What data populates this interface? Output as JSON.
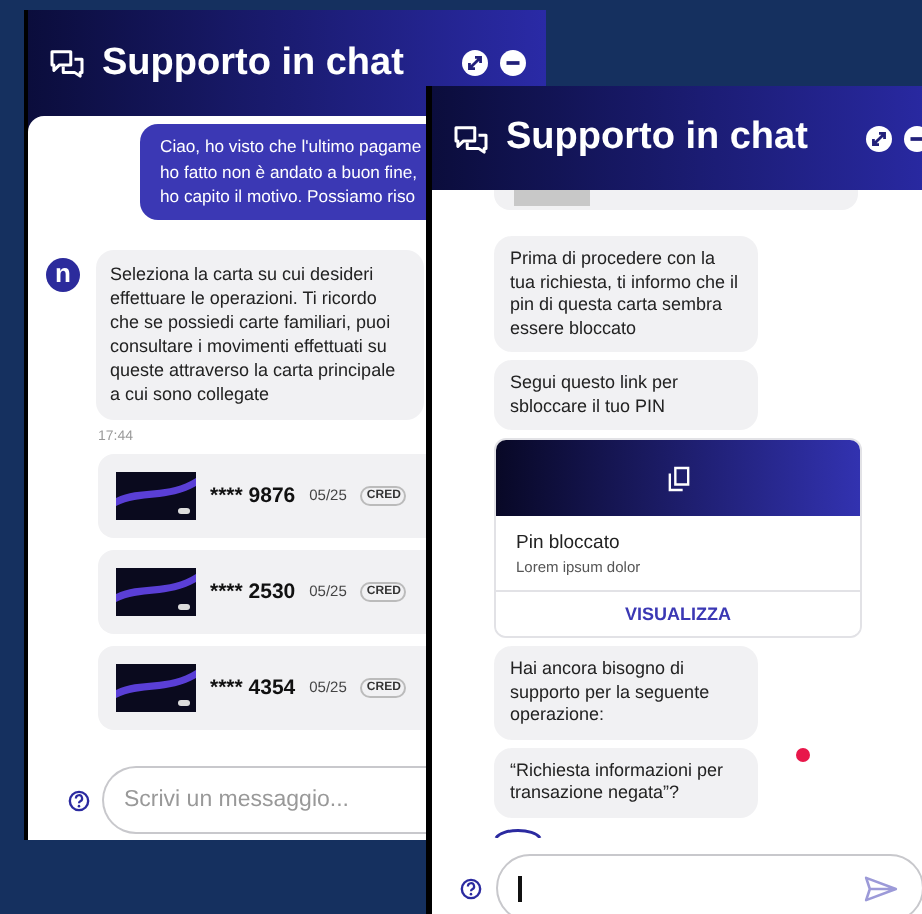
{
  "windows": [
    {
      "title": "Supporto in chat",
      "messages": [
        {
          "kind": "user",
          "lines": [
            "Ciao, ho visto che l'ultimo pagame",
            "ho fatto non è andato a buon fine,",
            "ho capito il motivo. Possiamo riso"
          ]
        },
        {
          "kind": "bot",
          "avatar": "n",
          "text": "Seleziona la carta su cui desideri effettuare le operazioni. Ti ricordo che se possiedi carte familiari, puoi consultare i movimenti effettuati su queste attraverso la carta principale a cui sono collegate",
          "unread": false
        },
        {
          "kind": "time",
          "text": "17:44"
        },
        {
          "kind": "card",
          "number": "**** 9876",
          "expiry": "05/25",
          "type": "CRED"
        },
        {
          "kind": "card",
          "number": "**** 2530",
          "expiry": "05/25",
          "type": "CRED"
        },
        {
          "kind": "card",
          "number": "**** 4354",
          "expiry": "05/25",
          "type": "CRED"
        }
      ],
      "input": {
        "placeholder": "Scrivi un messaggio..."
      }
    },
    {
      "title": "Supporto in chat",
      "messages": [
        {
          "kind": "card_edge"
        },
        {
          "kind": "bot",
          "text": "Prima di procedere con la tua richiesta, ti informo che il pin di questa carta sembra essere bloccato",
          "unread": false
        },
        {
          "kind": "bot",
          "text": "Segui questo link per sbloccare il tuo PIN",
          "unread": false
        },
        {
          "kind": "pin_card",
          "title": "Pin bloccato",
          "subtitle": "Lorem ipsum dolor",
          "action": "VISUALIZZA"
        },
        {
          "kind": "bot",
          "text": "Hai ancora bisogno di supporto per la seguente operazione:",
          "unread": false
        },
        {
          "kind": "bot",
          "text": "“Richiesta informazioni per transazione negata”?",
          "unread": true
        },
        {
          "kind": "loading"
        }
      ],
      "input": {
        "focused": true,
        "send": true
      }
    }
  ]
}
